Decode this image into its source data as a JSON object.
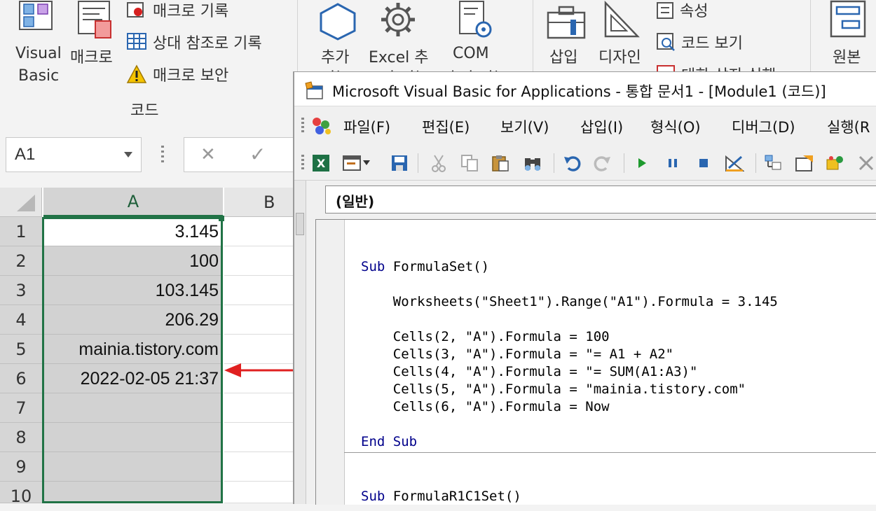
{
  "ribbon": {
    "visual_basic": [
      "Visual",
      "Basic"
    ],
    "macro": "매크로",
    "record_macro": "매크로 기록",
    "relative_ref": "상대 참조로 기록",
    "macro_security": "매크로 보안",
    "group_code": "코드",
    "addins": [
      "추가",
      "기능"
    ],
    "excel_addins": [
      "Excel 추",
      "가 기능"
    ],
    "com_addins": [
      "COM",
      "추가 기능"
    ],
    "insert": "삽입",
    "design_mode": [
      "디자인",
      "모드"
    ],
    "properties": "속성",
    "view_code": "코드 보기",
    "run_dialog": "대화 상자 실행",
    "source": "원본"
  },
  "formula_bar": {
    "name_box": "A1",
    "cancel": "✕",
    "enter": "✓"
  },
  "sheet": {
    "col_a": "A",
    "col_b": "B",
    "rows": [
      {
        "num": "1",
        "value": "3.145"
      },
      {
        "num": "2",
        "value": "100"
      },
      {
        "num": "3",
        "value": "103.145"
      },
      {
        "num": "4",
        "value": "206.29"
      },
      {
        "num": "5",
        "value": "mainia.tistory.com"
      },
      {
        "num": "6",
        "value": "2022-02-05 21:37"
      },
      {
        "num": "7",
        "value": ""
      },
      {
        "num": "8",
        "value": ""
      },
      {
        "num": "9",
        "value": ""
      },
      {
        "num": "10",
        "value": ""
      }
    ]
  },
  "vba": {
    "title": "Microsoft Visual Basic for Applications - 통합 문서1 - [Module1 (코드)]",
    "menu": [
      "파일(F)",
      "편집(E)",
      "보기(V)",
      "삽입(I)",
      "형식(O)",
      "디버그(D)",
      "실행(R"
    ],
    "object_combo": "(일반)",
    "code_lines_1": [
      {
        "kw": "Sub",
        "text": " FormulaSet()"
      },
      {
        "kw": "",
        "text": ""
      },
      {
        "kw": "",
        "text": "    Worksheets(\"Sheet1\").Range(\"A1\").Formula = 3.145"
      },
      {
        "kw": "",
        "text": ""
      },
      {
        "kw": "",
        "text": "    Cells(2, \"A\").Formula = 100"
      },
      {
        "kw": "",
        "text": "    Cells(3, \"A\").Formula = \"= A1 + A2\""
      },
      {
        "kw": "",
        "text": "    Cells(4, \"A\").Formula = \"= SUM(A1:A3)\""
      },
      {
        "kw": "",
        "text": "    Cells(5, \"A\").Formula = \"mainia.tistory.com\""
      },
      {
        "kw": "",
        "text": "    Cells(6, \"A\").Formula = Now"
      },
      {
        "kw": "",
        "text": ""
      },
      {
        "kw": "End Sub",
        "text": ""
      }
    ],
    "code_line_2": {
      "kw": "Sub",
      "text": " FormulaR1C1Set()"
    }
  },
  "colors": {
    "ribbon_bg": "#f3f3f3",
    "selection_border": "#217346",
    "arrow": "#e02020",
    "keyword": "#00008b",
    "excel_green": "#1e7145"
  }
}
